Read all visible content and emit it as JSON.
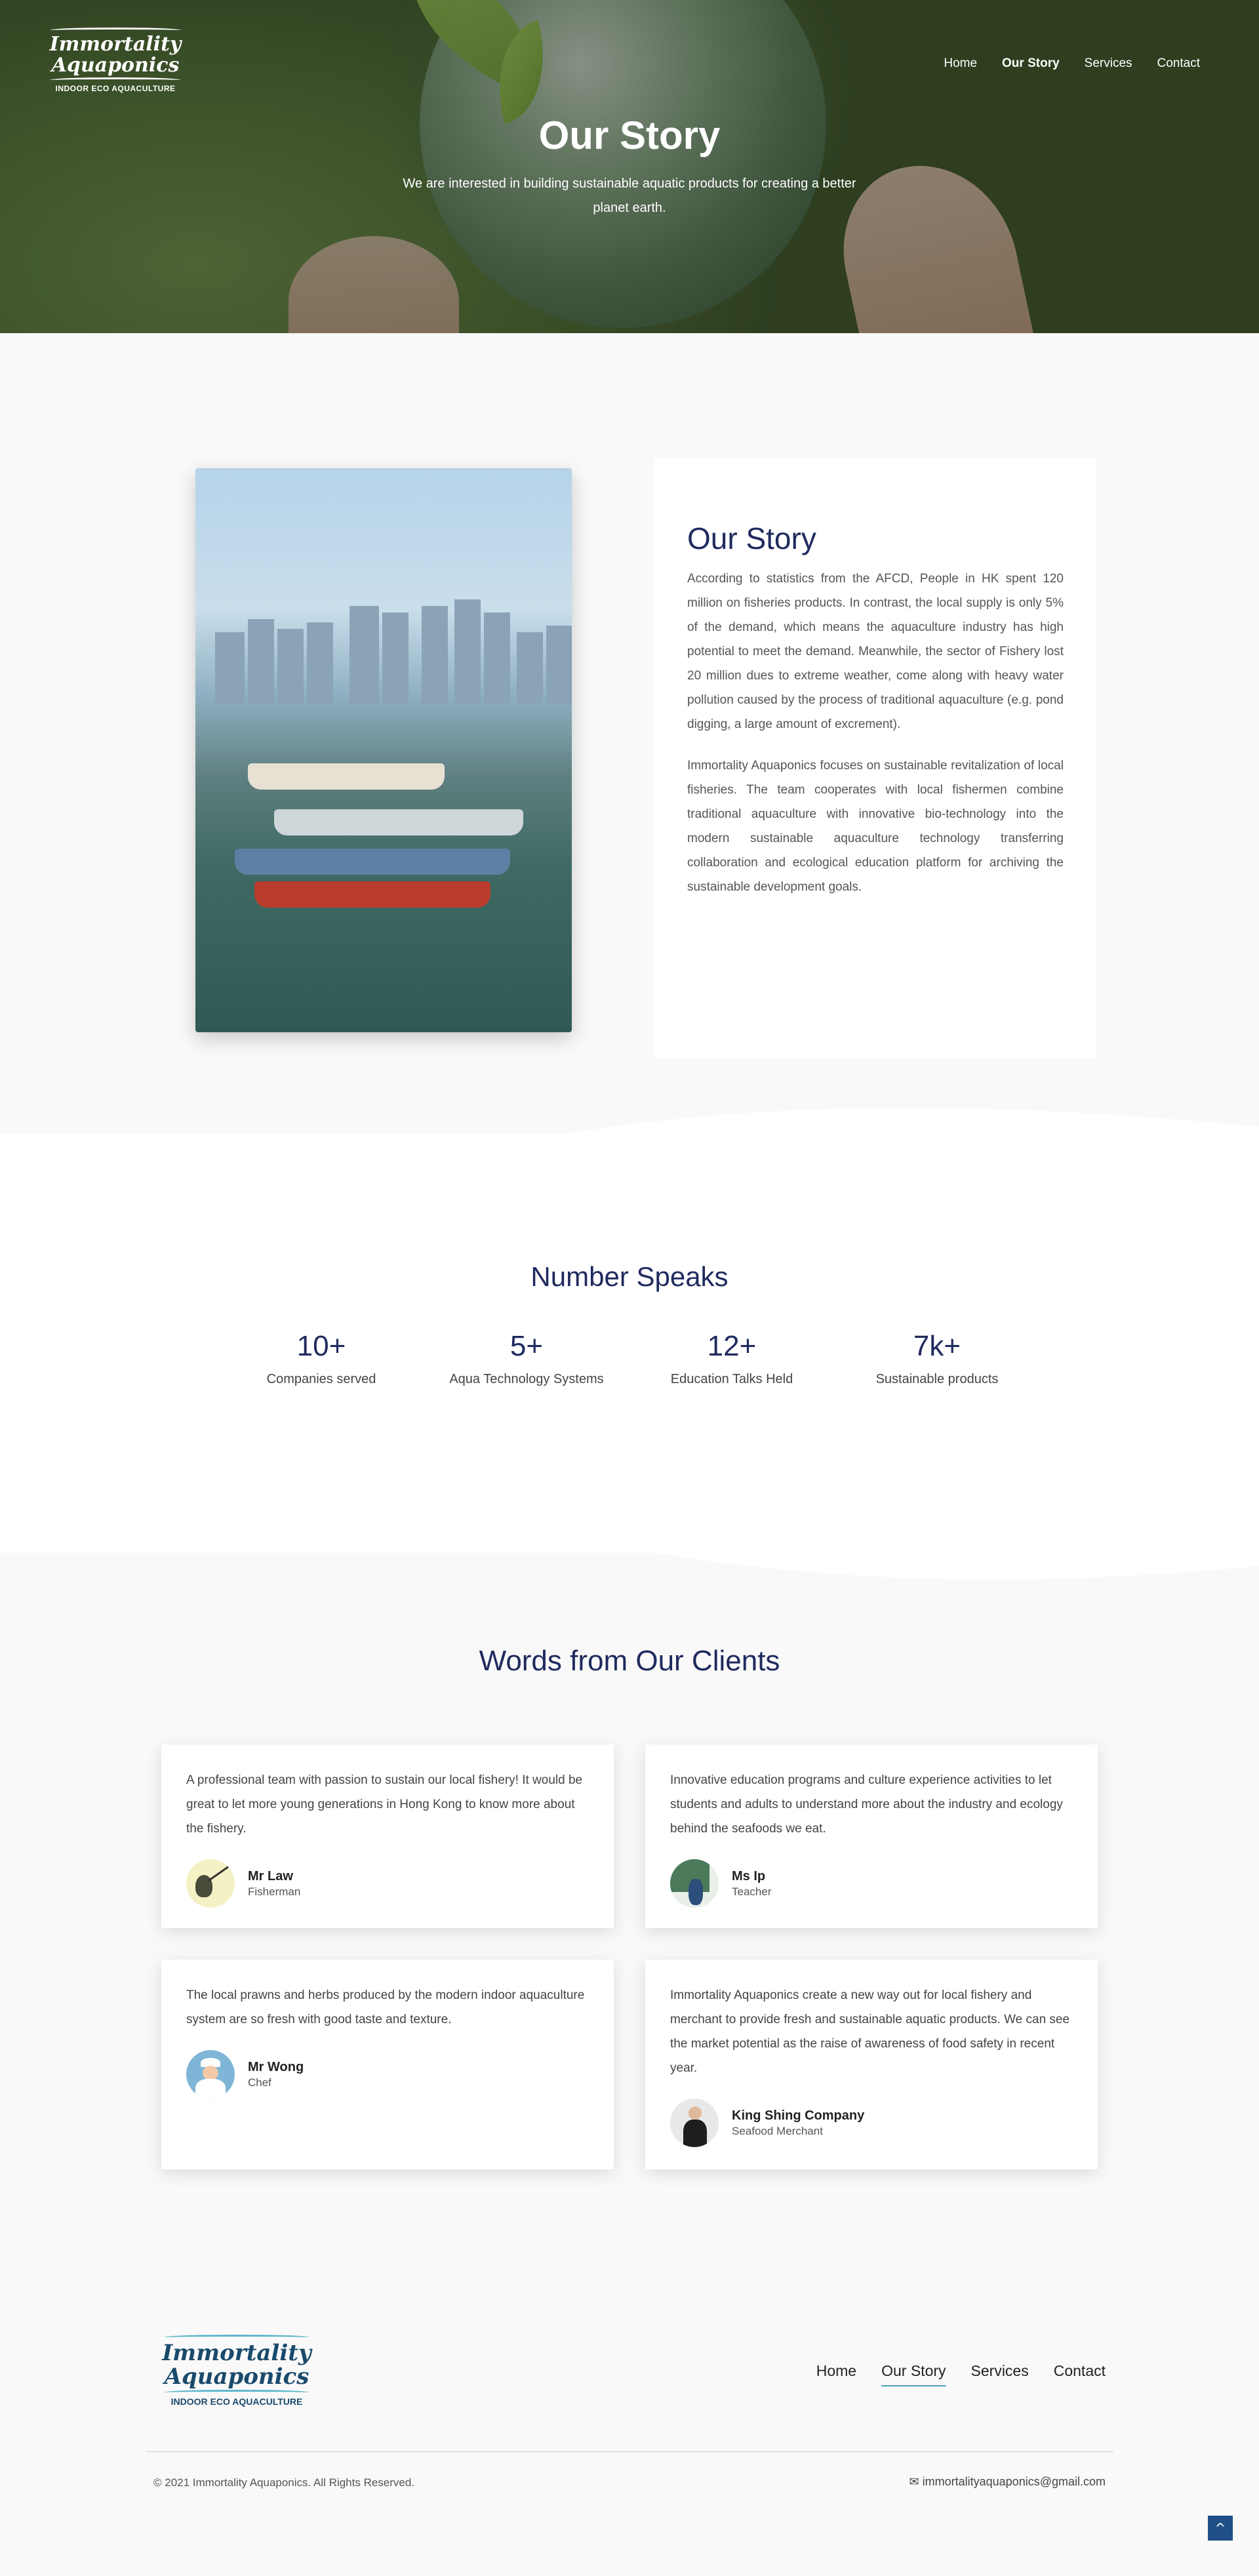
{
  "header": {
    "logo": {
      "line1": "Immortality",
      "line2": "Aquaponics",
      "tagline": "INDOOR ECO AQUACULTURE"
    },
    "nav": [
      "Home",
      "Our Story",
      "Services",
      "Contact"
    ],
    "title": "Our Story",
    "subtitle": "We are interested in building sustainable aquatic products for creating a better planet earth."
  },
  "story": {
    "title": "Our Story",
    "p1": "According to statistics from the AFCD, People in HK spent 120 million on fisheries products. In contrast, the local supply is only 5% of the demand, which means the aquaculture industry has high potential to meet the demand. Meanwhile, the sector of Fishery lost 20 million dues to extreme weather, come along with heavy water pollution caused by the process of traditional aquaculture (e.g. pond digging, a large amount of excrement).",
    "p2": "Immortality Aquaponics focuses on sustainable revitalization of local fisheries. The team cooperates with local fishermen combine traditional aquaculture with innovative bio-technology into the modern sustainable aquaculture technology transferring collaboration and ecological education platform for archiving the sustainable development goals."
  },
  "numbers": {
    "title": "Number Speaks",
    "stats": [
      {
        "value": "10+",
        "label": "Companies served"
      },
      {
        "value": "5+",
        "label": "Aqua Technology Systems"
      },
      {
        "value": "12+",
        "label": "Education Talks Held"
      },
      {
        "value": "7k+",
        "label": "Sustainable products"
      }
    ]
  },
  "clients": {
    "title": "Words from Our Clients",
    "items": [
      {
        "quote": "A professional team with passion to sustain our local fishery! It would be great to let more young generations in Hong Kong to know more about the fishery.",
        "name": "Mr Law",
        "role": "Fisherman"
      },
      {
        "quote": "Innovative education programs and culture experience activities to let students and adults to understand more about the industry and ecology behind the seafoods we eat.",
        "name": "Ms Ip",
        "role": "Teacher"
      },
      {
        "quote": "The local prawns and herbs produced by the modern indoor aquaculture system are so fresh with good taste and texture.",
        "name": "Mr Wong",
        "role": "Chef"
      },
      {
        "quote": "Immortality Aquaponics create a new way out for local fishery and merchant to provide fresh and sustainable aquatic products. We can see the market potential as the raise of awareness of food safety in recent year.",
        "name": "King Shing Company",
        "role": "Seafood Merchant"
      }
    ]
  },
  "footer": {
    "nav": [
      "Home",
      "Our Story",
      "Services",
      "Contact"
    ],
    "copyright": "© 2021 Immortality Aquaponics. All Rights Reserved.",
    "email": "immortalityaquaponics@gmail.com",
    "to_top": "^"
  },
  "colors": {
    "navy": "#1f2a5e",
    "accent": "#4aa0c0",
    "totop": "#1f4f86"
  }
}
